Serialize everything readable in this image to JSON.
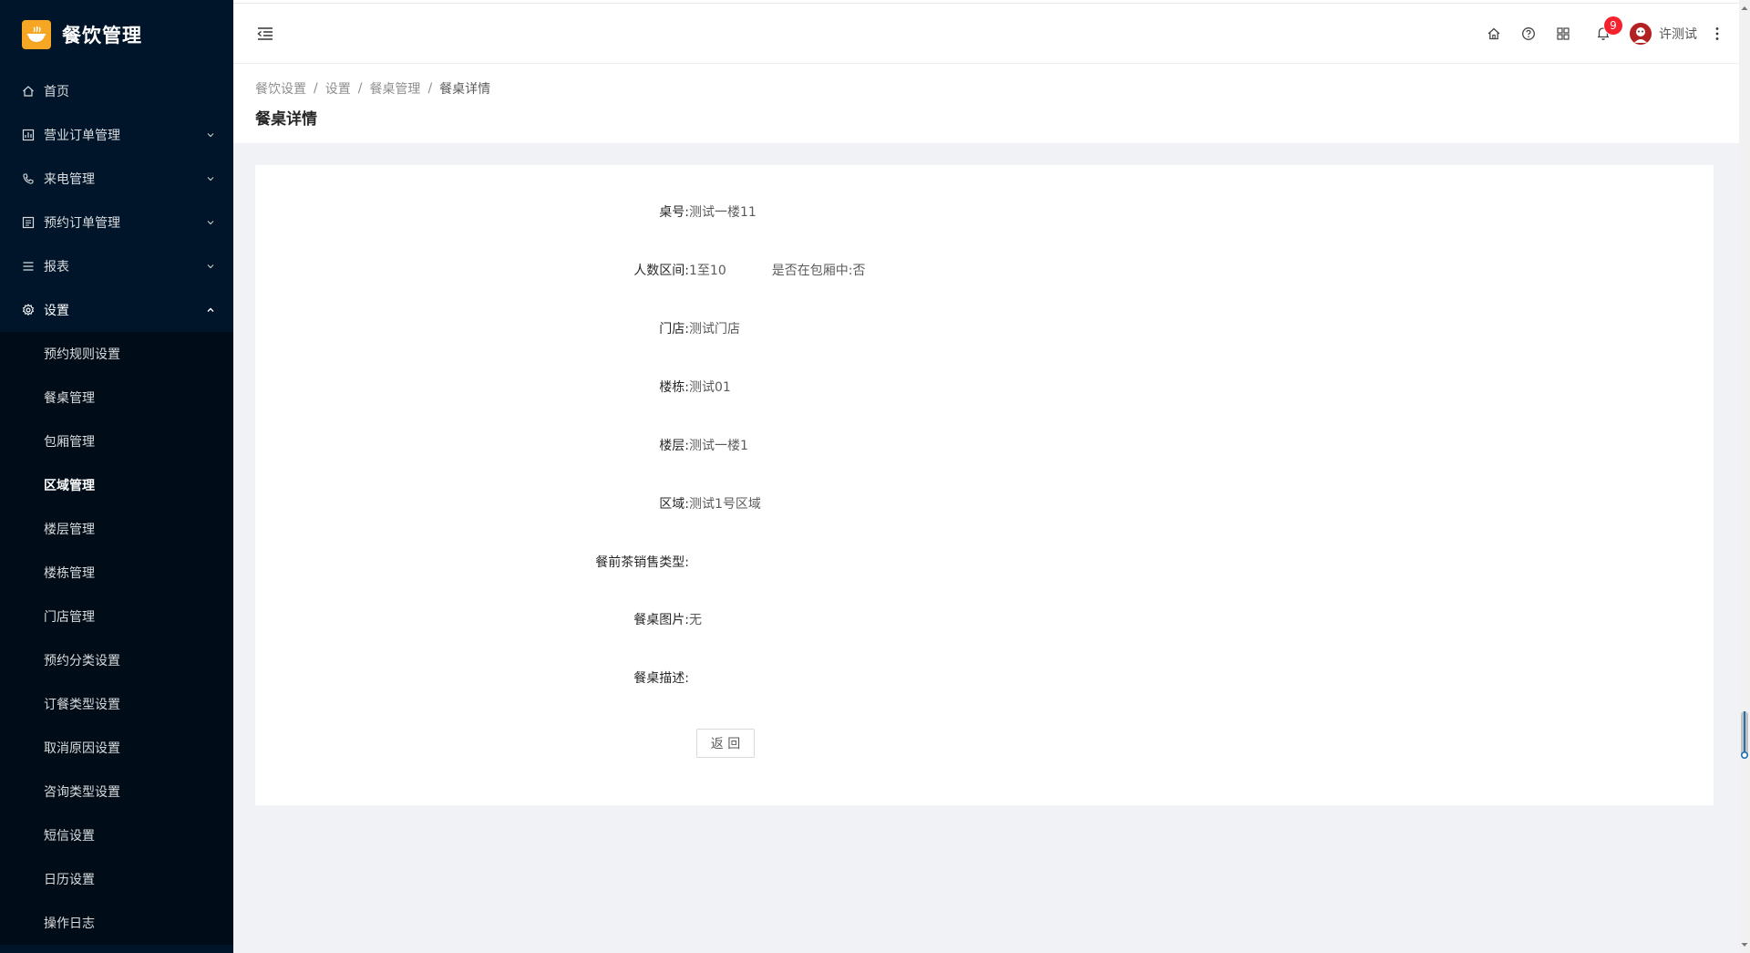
{
  "app": {
    "title": "餐饮管理"
  },
  "sidebar": {
    "items": [
      {
        "label": "首页",
        "icon": "home-icon"
      },
      {
        "label": "营业订单管理",
        "icon": "order-icon"
      },
      {
        "label": "来电管理",
        "icon": "phone-icon"
      },
      {
        "label": "预约订单管理",
        "icon": "reservation-icon"
      },
      {
        "label": "报表",
        "icon": "report-icon"
      },
      {
        "label": "设置",
        "icon": "gear-icon"
      }
    ],
    "settings_sub": [
      "预约规则设置",
      "餐桌管理",
      "包厢管理",
      "区域管理",
      "楼层管理",
      "楼栋管理",
      "门店管理",
      "预约分类设置",
      "订餐类型设置",
      "取消原因设置",
      "咨询类型设置",
      "短信设置",
      "日历设置",
      "操作日志"
    ],
    "active_sub": "区域管理"
  },
  "header": {
    "notification_count": "9",
    "user_name": "许测试"
  },
  "breadcrumb": [
    "餐饮设置",
    "设置",
    "餐桌管理",
    "餐桌详情"
  ],
  "page_title": "餐桌详情",
  "detail": {
    "table_no_label": "桌号:",
    "table_no": "测试一楼11",
    "people_label": "人数区间:",
    "people": "1至10",
    "in_room": "是否在包厢中:否",
    "store_label": "门店:",
    "store": "测试门店",
    "building_label": "楼栋:",
    "building": "测试01",
    "floor_label": "楼层:",
    "floor": "测试一楼1",
    "area_label": "区域:",
    "area": "测试1号区域",
    "tea_label": "餐前茶销售类型:",
    "tea": "",
    "image_label": "餐桌图片:",
    "image": "无",
    "desc_label": "餐桌描述:",
    "desc": ""
  },
  "back_button": "返 回",
  "colors": {
    "sidebar_bg": "#001529",
    "submenu_bg": "#000c17",
    "badge": "#f5222d",
    "logo": "#f5a623"
  }
}
